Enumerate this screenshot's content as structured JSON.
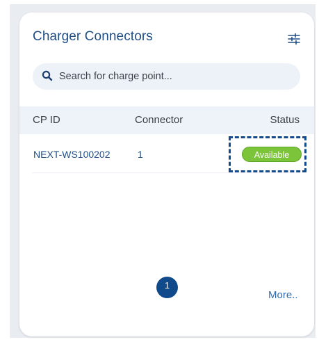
{
  "card": {
    "title": "Charger Connectors"
  },
  "search": {
    "placeholder": "Search for charge point..."
  },
  "table": {
    "headers": {
      "cp_id": "CP ID",
      "connector": "Connector",
      "status": "Status"
    },
    "rows": [
      {
        "cp_id": "NEXT-WS100202",
        "connector": "1",
        "status": "Available",
        "status_color": "#7cc43a"
      }
    ]
  },
  "pagination": {
    "current_page": "1",
    "more_label": "More.."
  },
  "icons": {
    "filter": "sliders-icon",
    "search": "search-icon"
  },
  "colors": {
    "accent": "#1f4e86",
    "page_active": "#114a8b",
    "status_available": "#7cc43a"
  }
}
